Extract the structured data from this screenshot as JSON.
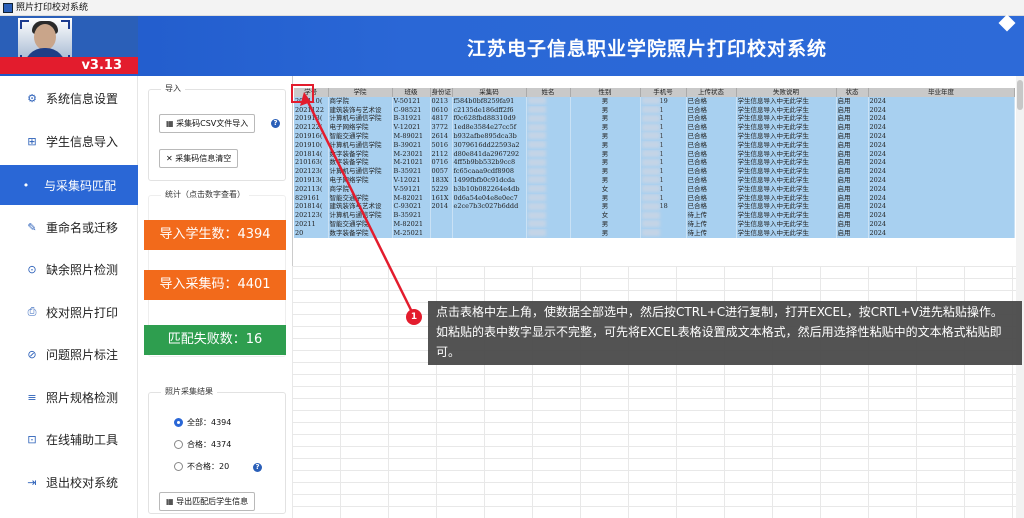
{
  "window_title": "照片打印校对系统",
  "app": {
    "version": "v3.13",
    "title": "江苏电子信息职业学院照片打印校对系统"
  },
  "nav": [
    {
      "label": "系统信息设置",
      "icon": "gear-icon",
      "glyph": "⚙"
    },
    {
      "label": "学生信息导入",
      "icon": "import-icon",
      "glyph": "⊞"
    },
    {
      "label": "与采集码匹配",
      "icon": "bullet-icon",
      "glyph": "•"
    },
    {
      "label": "重命名或迁移",
      "icon": "edit-icon",
      "glyph": "✎"
    },
    {
      "label": "缺余照片检测",
      "icon": "check-icon",
      "glyph": "⊙"
    },
    {
      "label": "校对照片打印",
      "icon": "print-icon",
      "glyph": "⎙"
    },
    {
      "label": "问题照片标注",
      "icon": "tag-icon",
      "glyph": "⊘"
    },
    {
      "label": "照片规格检测",
      "icon": "list-icon",
      "glyph": "≡"
    },
    {
      "label": "在线辅助工具",
      "icon": "tool-icon",
      "glyph": "⊡"
    },
    {
      "label": "退出校对系统",
      "icon": "exit-icon",
      "glyph": "⇥"
    }
  ],
  "panel": {
    "import_legend": "导入",
    "import_csv_button": "采集码CSV文件导入",
    "clear_button": "采集码信息清空",
    "stats_legend": "统计（点击数字查看）",
    "stat_students": "导入学生数：4394",
    "stat_codes": "导入采集码：4401",
    "stat_failed": "匹配失败数：16",
    "result_legend": "照片采集结果",
    "radio_all": "全部：4394",
    "radio_pass": "合格：4374",
    "radio_fail": "不合格：20",
    "export_button": "导出匹配后学生信息"
  },
  "colors": {
    "blue": "#2a67d6",
    "orange": "#f26a1b",
    "green": "#2e9e4f",
    "red": "#e31c2d"
  },
  "table": {
    "headers": [
      "学号",
      "学院",
      "班级",
      "身份证",
      "采集码",
      "姓名",
      "性别",
      "手机号",
      "上传状态",
      "失败说明",
      "状态",
      "毕业年度"
    ],
    "rows": [
      [
        "202110(",
        "商学院",
        "V-50121",
        "0213",
        "f584b0bf8259fa91",
        "",
        "男",
        "19",
        "已合格",
        "学生信息导入中无此学生",
        "启用",
        "2024"
      ],
      [
        "2021122",
        "建筑装饰与艺术设",
        "C-98521",
        "0610",
        "c2135de186dff2f6",
        "",
        "男",
        "1",
        "已合格",
        "学生信息导入中无此学生",
        "启用",
        "2024"
      ],
      [
        "201913(",
        "计算机与通信学院",
        "B-31921",
        "4817",
        "f0c628fbd88310d9",
        "",
        "男",
        "1",
        "已合格",
        "学生信息导入中无此学生",
        "启用",
        "2024"
      ],
      [
        "202122(",
        "电子网络学院",
        "V-12021",
        "3772",
        "1ed8e3584e27cc5f",
        "",
        "男",
        "1",
        "已合格",
        "学生信息导入中无此学生",
        "启用",
        "2024"
      ],
      [
        "201916(",
        "智能交通学院",
        "M-89021",
        "2614",
        "b932afbe895dca3b",
        "",
        "男",
        "1",
        "已合格",
        "学生信息导入中无此学生",
        "启用",
        "2024"
      ],
      [
        "201910(",
        "计算机与通信学院",
        "B-39021",
        "5016",
        "3079616dd22593a2",
        "",
        "男",
        "1",
        "已合格",
        "学生信息导入中无此学生",
        "启用",
        "2024"
      ],
      [
        "201814(",
        "数字装备学院",
        "M-23021",
        "2112",
        "d80e841da2967292",
        "",
        "男",
        "1",
        "已合格",
        "学生信息导入中无此学生",
        "启用",
        "2024"
      ],
      [
        "210163(",
        "数字装备学院",
        "M-21021",
        "0716",
        "4ff5b9bb532b9cc8",
        "",
        "男",
        "1",
        "已合格",
        "学生信息导入中无此学生",
        "启用",
        "2024"
      ],
      [
        "202123(",
        "计算机与通信学院",
        "B-35921",
        "0057",
        "fc65caaa9cdf8908",
        "",
        "男",
        "1",
        "已合格",
        "学生信息导入中无此学生",
        "启用",
        "2024"
      ],
      [
        "201913(",
        "电子网络学院",
        "V-12021",
        "183X",
        "1499fbfb0c91dcda",
        "",
        "男",
        "1",
        "已合格",
        "学生信息导入中无此学生",
        "启用",
        "2024"
      ],
      [
        "202113(",
        "商学院",
        "V-59121",
        "5229",
        "b3b10b082264e4db",
        "",
        "女",
        "1",
        "已合格",
        "学生信息导入中无此学生",
        "启用",
        "2024"
      ],
      [
        "829161",
        "智能交通学院",
        "M-82021",
        "161X",
        "0d6a54e04e8e0ec7",
        "",
        "男",
        "1",
        "已合格",
        "学生信息导入中无此学生",
        "启用",
        "2024"
      ],
      [
        "201814(",
        "建筑装饰与艺术设",
        "C-93021",
        "2014",
        "e2ce7b3c027b6ddd",
        "",
        "男",
        "18",
        "已合格",
        "学生信息导入中无此学生",
        "启用",
        "2024"
      ],
      [
        "202123(",
        "计算机与通信学院",
        "B-35921",
        "",
        "",
        "",
        "女",
        "",
        "待上传",
        "学生信息导入中无此学生",
        "启用",
        "2024"
      ],
      [
        "20211",
        "智能交通学院",
        "M-82021",
        "",
        "",
        "",
        "男",
        "",
        "待上传",
        "学生信息导入中无此学生",
        "启用",
        "2024"
      ],
      [
        "20",
        "数字装备学院",
        "M-25021",
        "",
        "",
        "",
        "男",
        "",
        "待上传",
        "学生信息导入中无此学生",
        "启用",
        "2024"
      ]
    ]
  },
  "tooltip": {
    "badge": "1",
    "text": "点击表格中左上角，使数据全部选中，然后按CTRL+C进行复制，打开EXCEL，按CRTL+V进先粘贴操作。如粘贴的表中数字显示不完整，可先将EXCEL表格设置成文本格式，然后用选择性粘贴中的文本格式粘贴即可。"
  }
}
